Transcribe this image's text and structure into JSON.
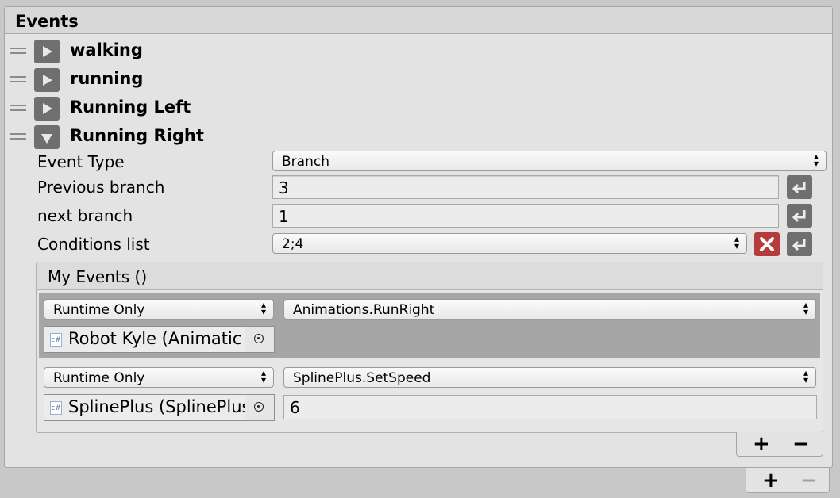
{
  "panel": {
    "title": "Events"
  },
  "events": [
    {
      "name": "walking",
      "expanded": false
    },
    {
      "name": "running",
      "expanded": false
    },
    {
      "name": "Running Left",
      "expanded": false
    },
    {
      "name": "Running Right",
      "expanded": true
    }
  ],
  "properties": {
    "event_type": {
      "label": "Event Type",
      "value": "Branch"
    },
    "previous_branch": {
      "label": "Previous branch",
      "value": "3"
    },
    "next_branch": {
      "label": "next branch",
      "value": "1"
    },
    "conditions_list": {
      "label": "Conditions list",
      "value": "2;4"
    }
  },
  "my_events": {
    "title": "My Events ()",
    "listeners": [
      {
        "call_state": "Runtime Only",
        "function": "Animations.RunRight",
        "target": "Robot Kyle (Animatic",
        "target_icon": "c#",
        "selected": true
      },
      {
        "call_state": "Runtime Only",
        "function": "SplinePlus.SetSpeed",
        "target": "SplinePlus (SplinePlus",
        "target_icon": "c#",
        "argument": "6",
        "selected": false
      }
    ],
    "footer": {
      "plus": "+",
      "minus": "−"
    }
  },
  "panel_footer": {
    "plus": "+",
    "minus": "−"
  },
  "colors": {
    "panel_bg": "#e3e3e3",
    "selected_row": "#a6a6a6",
    "button_dark": "#6f6f6f",
    "remove_red": "#b53c3c"
  }
}
